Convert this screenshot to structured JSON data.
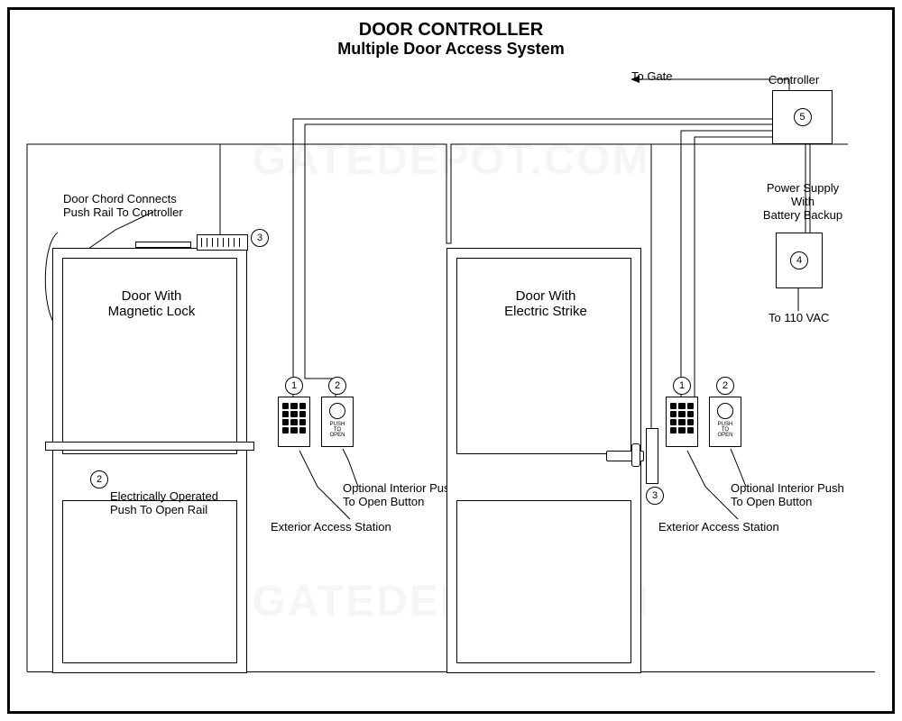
{
  "title_line1": "DOOR CONTROLLER",
  "title_line2": "Multiple Door Access System",
  "watermark": "GATEDEPOT.COM",
  "to_gate": "To Gate",
  "controller_label": "Controller",
  "power_supply_line1": "Power Supply",
  "power_supply_line2": "With",
  "power_supply_line3": "Battery Backup",
  "to_110vac": "To 110 VAC",
  "door1_label_line1": "Door With",
  "door1_label_line2": "Magnetic Lock",
  "door2_label_line1": "Door With",
  "door2_label_line2": "Electric Strike",
  "door_chord_line1": "Door Chord Connects",
  "door_chord_line2": "Push Rail To Controller",
  "push_rail_line1": "Electrically Operated",
  "push_rail_line2": "Push To Open Rail",
  "opt_push_line1": "Optional Interior Push",
  "opt_push_line2": "To Open Button",
  "ext_access": "Exterior Access Station",
  "pto_line1": "PUSH",
  "pto_line2": "TO",
  "pto_line3": "OPEN",
  "n1": "1",
  "n2": "2",
  "n3": "3",
  "n4": "4",
  "n5": "5"
}
